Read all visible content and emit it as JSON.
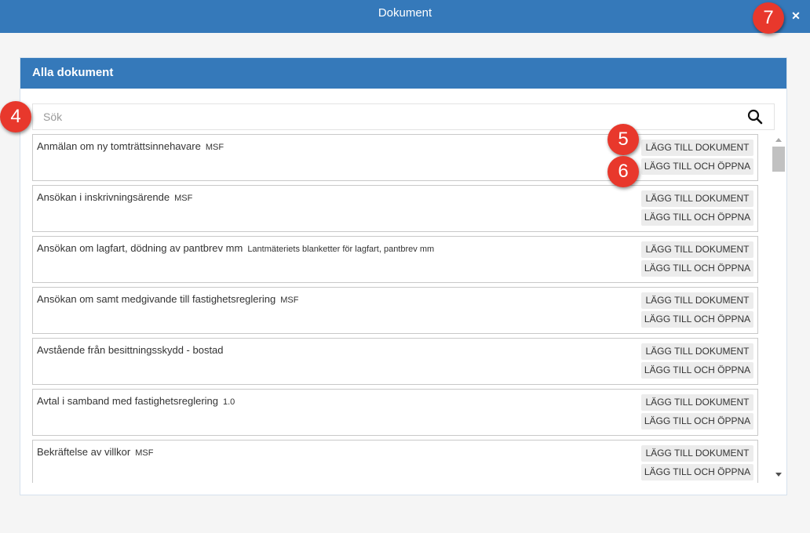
{
  "dialog": {
    "title": "Dokument",
    "close_glyph": "✕"
  },
  "panel": {
    "title": "Alla dokument"
  },
  "search": {
    "placeholder": "Sök"
  },
  "documents": [
    {
      "name": "Anmälan om ny tomträttsinnehavare",
      "tag": "MSF",
      "add_label": "LÄGG TILL DOKUMENT",
      "add_open_label": "LÄGG TILL OCH ÖPPNA"
    },
    {
      "name": "Ansökan i inskrivningsärende",
      "tag": "MSF",
      "add_label": "LÄGG TILL DOKUMENT",
      "add_open_label": "LÄGG TILL OCH ÖPPNA"
    },
    {
      "name": "Ansökan om lagfart, dödning av pantbrev mm",
      "tag": "Lantmäteriets blanketter för lagfart, pantbrev mm",
      "add_label": "LÄGG TILL DOKUMENT",
      "add_open_label": "LÄGG TILL OCH ÖPPNA"
    },
    {
      "name": "Ansökan om samt medgivande till fastighetsreglering",
      "tag": "MSF",
      "add_label": "LÄGG TILL DOKUMENT",
      "add_open_label": "LÄGG TILL OCH ÖPPNA"
    },
    {
      "name": "Avstående från besittningsskydd - bostad",
      "tag": "",
      "add_label": "LÄGG TILL DOKUMENT",
      "add_open_label": "LÄGG TILL OCH ÖPPNA"
    },
    {
      "name": "Avtal i samband med fastighetsreglering",
      "tag": "1.0",
      "add_label": "LÄGG TILL DOKUMENT",
      "add_open_label": "LÄGG TILL OCH ÖPPNA"
    },
    {
      "name": "Bekräftelse av villkor",
      "tag": "MSF",
      "add_label": "LÄGG TILL DOKUMENT",
      "add_open_label": "LÄGG TILL OCH ÖPPNA"
    }
  ],
  "annotations": {
    "marker_search": "4",
    "marker_add": "5",
    "marker_add_open": "6",
    "marker_close": "7"
  },
  "colors": {
    "header_blue": "#3579ba",
    "marker_red": "#e8382c",
    "button_gray": "#ececec"
  },
  "icons": {
    "search": "search-icon",
    "close": "close-icon",
    "scroll_up": "scroll-up-arrow-icon",
    "scroll_down": "scroll-down-arrow-icon"
  }
}
